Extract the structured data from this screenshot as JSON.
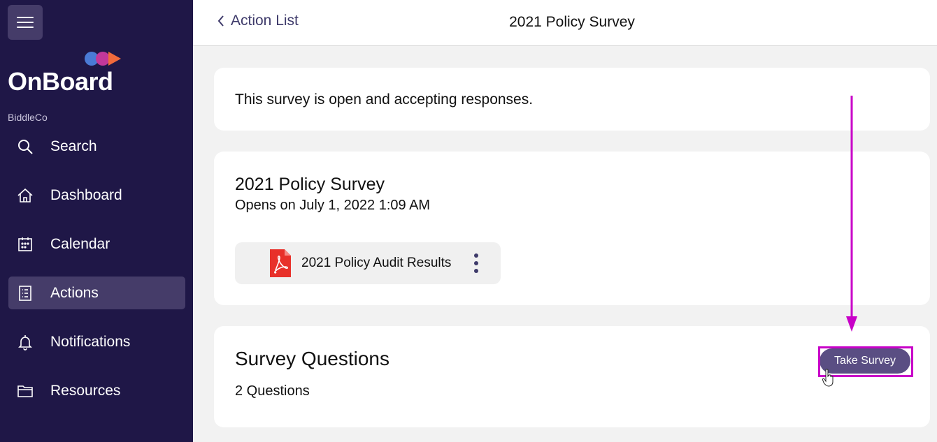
{
  "sidebar": {
    "logo_text": "OnBoard",
    "org_name": "BiddleCo",
    "items": [
      {
        "label": "Search",
        "icon": "search-icon",
        "active": false
      },
      {
        "label": "Dashboard",
        "icon": "home-icon",
        "active": false
      },
      {
        "label": "Calendar",
        "icon": "calendar-icon",
        "active": false
      },
      {
        "label": "Actions",
        "icon": "checklist-icon",
        "active": true
      },
      {
        "label": "Notifications",
        "icon": "bell-icon",
        "active": false
      },
      {
        "label": "Resources",
        "icon": "folder-icon",
        "active": false
      }
    ]
  },
  "header": {
    "back_label": "Action List",
    "title": "2021 Policy Survey"
  },
  "status": {
    "text": "This survey is open and accepting responses."
  },
  "survey": {
    "title": "2021 Policy Survey",
    "opens": "Opens on July 1, 2022 1:09 AM",
    "attachment": {
      "name": "2021 Policy Audit Results",
      "icon": "pdf-icon"
    }
  },
  "questions": {
    "title": "Survey Questions",
    "count": "2 Questions",
    "button_label": "Take Survey"
  },
  "colors": {
    "sidebar_bg": "#1f1747",
    "active_item": "#453c69",
    "button": "#5a4e83",
    "annotation": "#c800c8",
    "pdf_red": "#e8312a"
  }
}
